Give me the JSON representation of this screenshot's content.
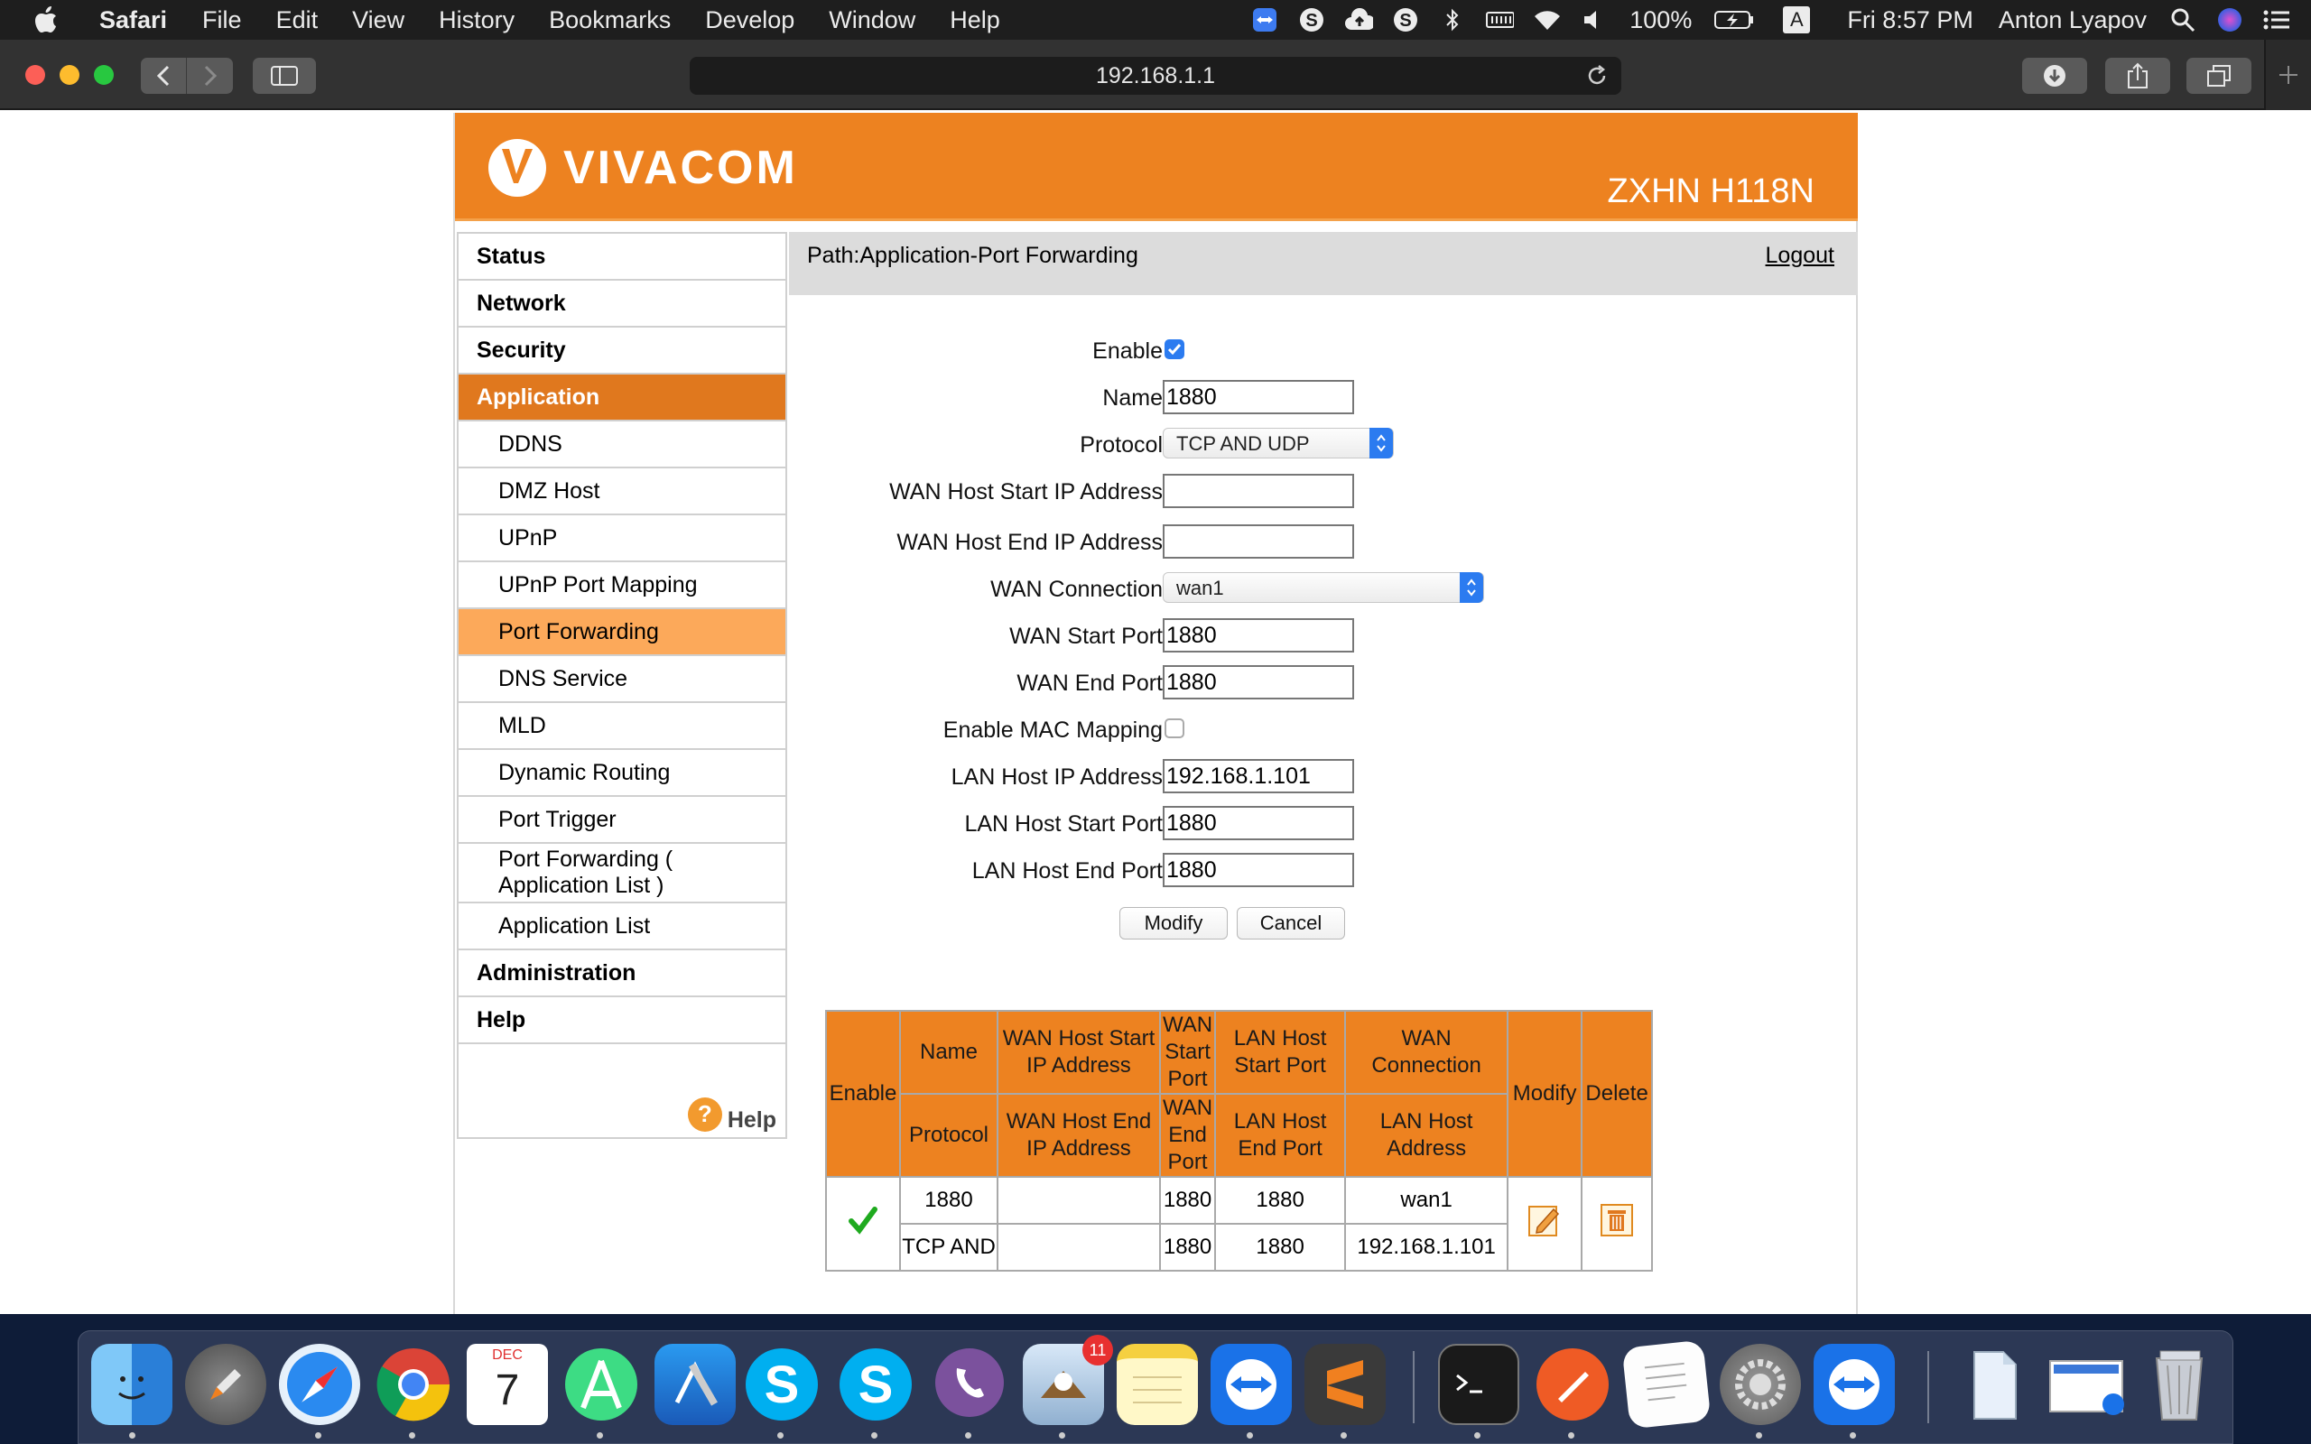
{
  "menubar": {
    "app": "Safari",
    "items": [
      "File",
      "Edit",
      "View",
      "History",
      "Bookmarks",
      "Develop",
      "Window",
      "Help"
    ],
    "battery": "100%",
    "input_source": "A",
    "clock": "Fri 8:57 PM",
    "user": "Anton Lyapov"
  },
  "browser": {
    "url": "192.168.1.1"
  },
  "router": {
    "brand": "VIVACOM",
    "model": "ZXHN H118N",
    "path": "Path:Application-Port Forwarding",
    "logout": "Logout",
    "help": "Help",
    "sidebar": [
      {
        "label": "Status",
        "level": "top"
      },
      {
        "label": "Network",
        "level": "top"
      },
      {
        "label": "Security",
        "level": "top"
      },
      {
        "label": "Application",
        "level": "top",
        "active": true
      },
      {
        "label": "DDNS",
        "level": "sub"
      },
      {
        "label": "DMZ Host",
        "level": "sub"
      },
      {
        "label": "UPnP",
        "level": "sub"
      },
      {
        "label": "UPnP Port Mapping",
        "level": "sub"
      },
      {
        "label": "Port Forwarding",
        "level": "sub",
        "active": true
      },
      {
        "label": "DNS Service",
        "level": "sub"
      },
      {
        "label": "MLD",
        "level": "sub"
      },
      {
        "label": "Dynamic Routing",
        "level": "sub"
      },
      {
        "label": "Port Trigger",
        "level": "sub"
      },
      {
        "label": "Port Forwarding ( Application List )",
        "level": "sub"
      },
      {
        "label": "Application List",
        "level": "sub"
      },
      {
        "label": "Administration",
        "level": "top"
      },
      {
        "label": "Help",
        "level": "top"
      }
    ],
    "form": {
      "enable_label": "Enable",
      "enable_checked": true,
      "name_label": "Name",
      "name_value": "1880",
      "protocol_label": "Protocol",
      "protocol_value": "TCP AND UDP",
      "wan_start_ip_label": "WAN Host Start IP Address",
      "wan_start_ip_value": "",
      "wan_end_ip_label": "WAN Host End IP Address",
      "wan_end_ip_value": "",
      "wan_conn_label": "WAN Connection",
      "wan_conn_value": "wan1",
      "wan_start_port_label": "WAN Start Port",
      "wan_start_port_value": "1880",
      "wan_end_port_label": "WAN End Port",
      "wan_end_port_value": "1880",
      "mac_label": "Enable MAC Mapping",
      "mac_checked": false,
      "lan_ip_label": "LAN Host IP Address",
      "lan_ip_value": "192.168.1.101",
      "lan_start_port_label": "LAN Host Start Port",
      "lan_start_port_value": "1880",
      "lan_end_port_label": "LAN Host End Port",
      "lan_end_port_value": "1880",
      "modify_label": "Modify",
      "cancel_label": "Cancel"
    },
    "table": {
      "h_enable": "Enable",
      "h_name": "Name",
      "h_wan_start_ip": "WAN Host Start IP Address",
      "h_wan_start_port": "WAN Start Port",
      "h_lan_start_port": "LAN Host Start Port",
      "h_wan_conn": "WAN Connection",
      "h_modify": "Modify",
      "h_delete": "Delete",
      "h_protocol": "Protocol",
      "h_wan_end_ip": "WAN Host End IP Address",
      "h_wan_end_port": "WAN End Port",
      "h_lan_end_port": "LAN Host End Port",
      "h_lan_ip": "LAN Host Address",
      "row": {
        "name": "1880",
        "wan_start_ip": "",
        "wan_start_port": "1880",
        "lan_start_port": "1880",
        "wan_conn": "wan1",
        "protocol": "TCP AND",
        "wan_end_ip": "",
        "wan_end_port": "1880",
        "lan_end_port": "1880",
        "lan_ip": "192.168.1.101"
      }
    }
  },
  "dock": {
    "mail_badge": "11",
    "calendar_month": "DEC",
    "calendar_day": "7",
    "apps": [
      "finder-icon",
      "launchpad-icon",
      "safari-icon",
      "chrome-icon",
      "calendar-icon",
      "android-studio-icon",
      "xcode-icon",
      "skype-icon",
      "skype-icon-2",
      "viber-icon",
      "mail-icon",
      "notes-icon",
      "teamviewer-icon",
      "sublime-icon",
      "terminal-icon",
      "postman-icon",
      "textedit-icon",
      "system-preferences-icon",
      "teamviewer-icon-2",
      "documents-icon",
      "screenshot-icon",
      "trash-icon"
    ]
  },
  "colors": {
    "brand_orange": "#ed8220",
    "nav_active": "#e0781e",
    "subnav_active": "#fca95a",
    "checkbox_blue": "#2b7bf0",
    "check_green": "#1faa1f"
  }
}
